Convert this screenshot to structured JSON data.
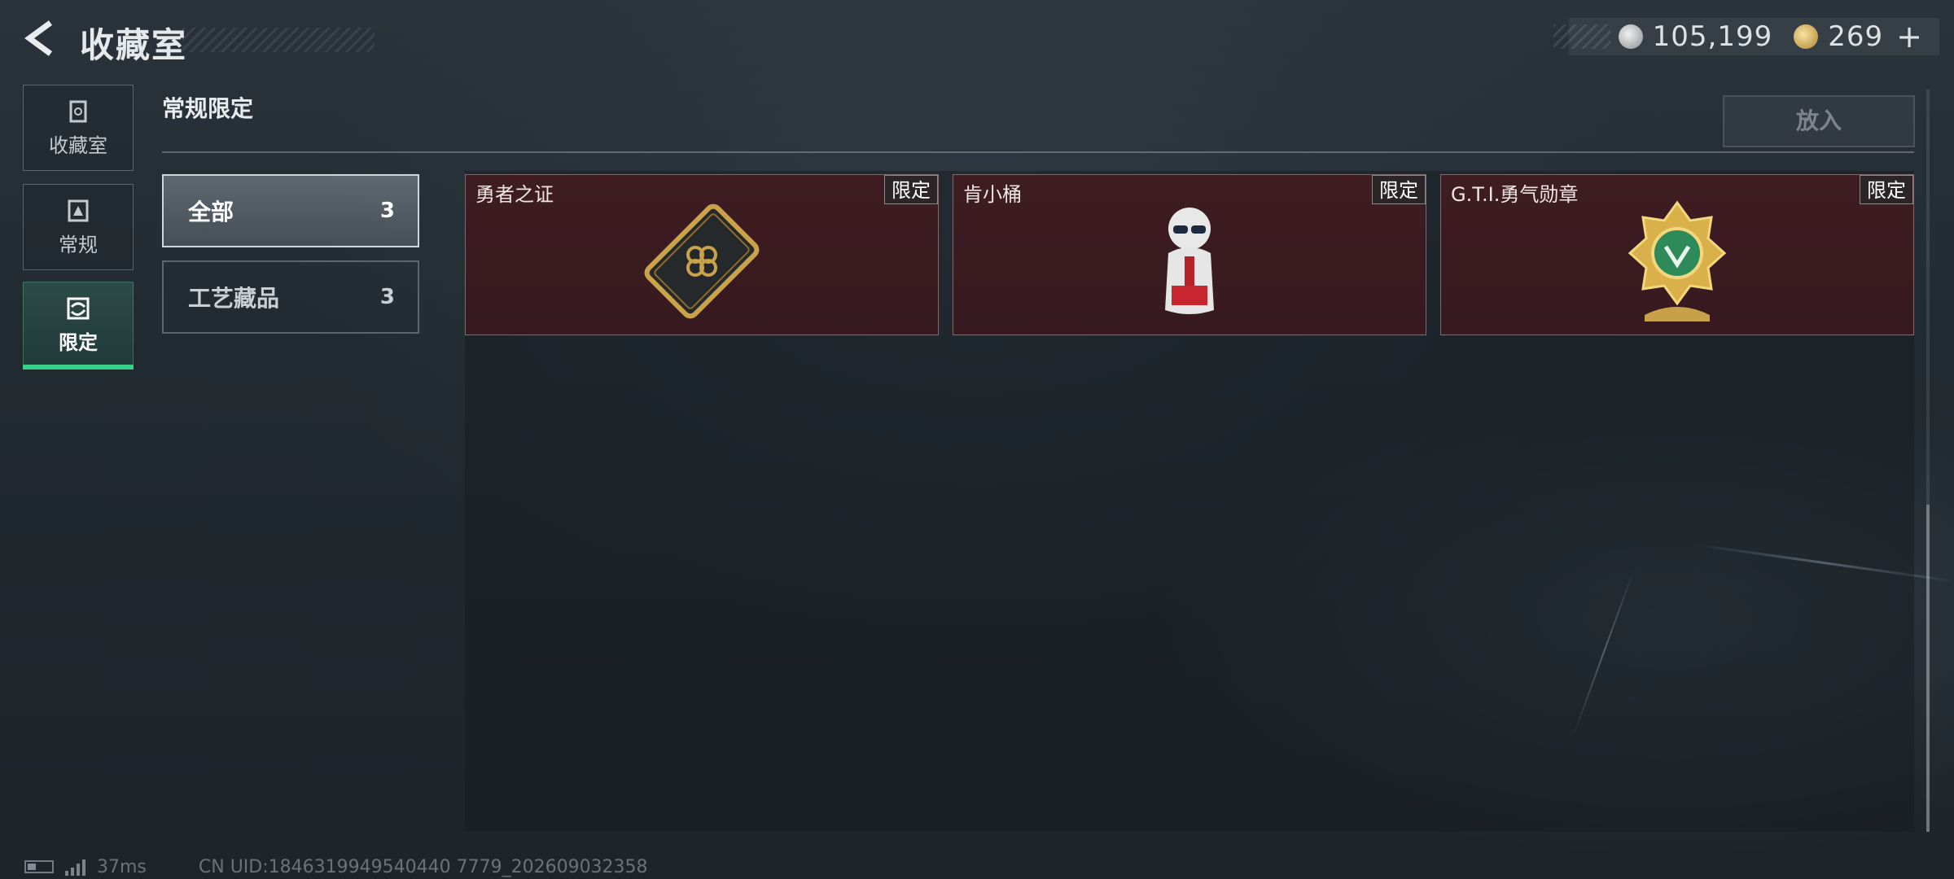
{
  "header": {
    "title": "收藏室",
    "currency": [
      {
        "icon": "silver-coin-icon",
        "value": "105,199"
      },
      {
        "icon": "gold-coin-icon",
        "value": "269"
      }
    ],
    "add_label": "+"
  },
  "nav": {
    "items": [
      {
        "label": "收藏室",
        "icon": "collection-icon"
      },
      {
        "label": "常规",
        "icon": "regular-icon"
      },
      {
        "label": "限定",
        "icon": "limited-icon",
        "active": true
      }
    ]
  },
  "section": {
    "title": "常规限定",
    "put_button": "放入"
  },
  "categories": [
    {
      "label": "全部",
      "count": "3",
      "active": true
    },
    {
      "label": "工艺藏品",
      "count": "3",
      "active": false
    }
  ],
  "cards": [
    {
      "name": "勇者之证",
      "tag": "限定",
      "icon": "card-badge-icon"
    },
    {
      "name": "肯小桶",
      "tag": "限定",
      "icon": "colonel-figure-icon"
    },
    {
      "name": "G.T.I.勇气勋章",
      "tag": "限定",
      "icon": "gold-medal-icon"
    }
  ],
  "footer": {
    "ping": "37ms",
    "uid": "CN UID:1846319949540440 7779_202609032358"
  },
  "colors": {
    "accent_green": "#39d18a",
    "card_bg": "#3e1c22"
  }
}
